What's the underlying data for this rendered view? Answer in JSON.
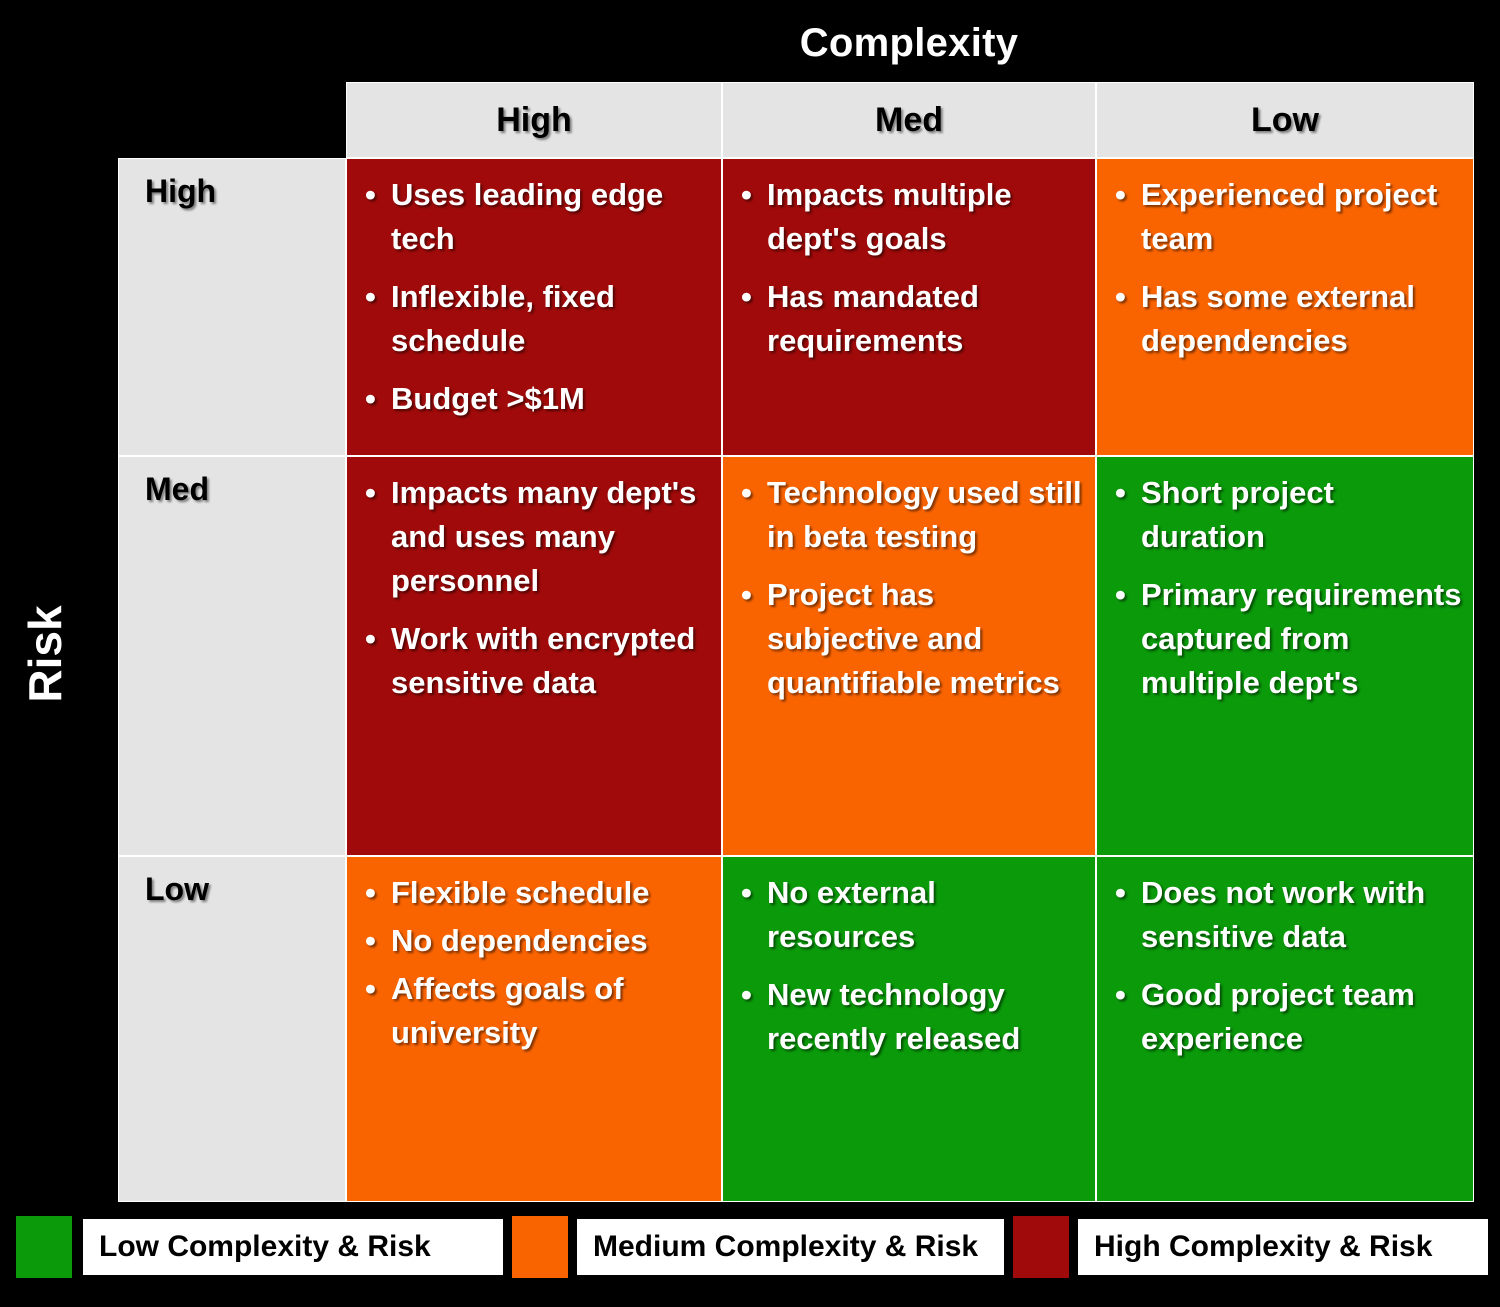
{
  "axes": {
    "column_axis_title": "Complexity",
    "row_axis_title": "Risk",
    "column_headers": [
      "High",
      "Med",
      "Low"
    ],
    "row_headers": [
      "High",
      "Med",
      "Low"
    ]
  },
  "colors": {
    "high": "#a00a0a",
    "medium": "#fa6400",
    "low": "#0a9a0a",
    "header_fill": "#e4e4e4",
    "background": "#000000",
    "cell_text": "#ffffff"
  },
  "matrix": {
    "bullet_glyph": "•",
    "cells": [
      {
        "row": "High",
        "column": "High",
        "level": "high",
        "items": [
          "Uses leading edge tech",
          "Inflexible, fixed schedule",
          "Budget >$1M"
        ]
      },
      {
        "row": "High",
        "column": "Med",
        "level": "high",
        "items": [
          "Impacts multiple dept's goals",
          "Has mandated requirements"
        ]
      },
      {
        "row": "High",
        "column": "Low",
        "level": "medium",
        "items": [
          "Experienced project team",
          "Has some external dependencies"
        ]
      },
      {
        "row": "Med",
        "column": "High",
        "level": "high",
        "items": [
          "Impacts many dept's and uses many personnel",
          "Work with encrypted sensitive data"
        ]
      },
      {
        "row": "Med",
        "column": "Med",
        "level": "medium",
        "items": [
          "Technology used still in beta testing",
          "Project has subjective and quantifiable metrics"
        ]
      },
      {
        "row": "Med",
        "column": "Low",
        "level": "low",
        "items": [
          "Short project duration",
          "Primary requirements captured from multiple dept's"
        ]
      },
      {
        "row": "Low",
        "column": "High",
        "level": "medium",
        "items": [
          "Flexible schedule",
          "No dependencies",
          "Affects goals of university"
        ]
      },
      {
        "row": "Low",
        "column": "Med",
        "level": "low",
        "items": [
          "No external resources",
          "New technology recently released"
        ]
      },
      {
        "row": "Low",
        "column": "Low",
        "level": "low",
        "items": [
          "Does not work with sensitive data",
          "Good project team experience"
        ]
      }
    ]
  },
  "legend": {
    "items": [
      {
        "label": "Low Complexity & Risk",
        "color": "#0a9a0a"
      },
      {
        "label": "Medium Complexity & Risk",
        "color": "#fa6400"
      },
      {
        "label": "High Complexity & Risk",
        "color": "#a00a0a"
      }
    ]
  }
}
